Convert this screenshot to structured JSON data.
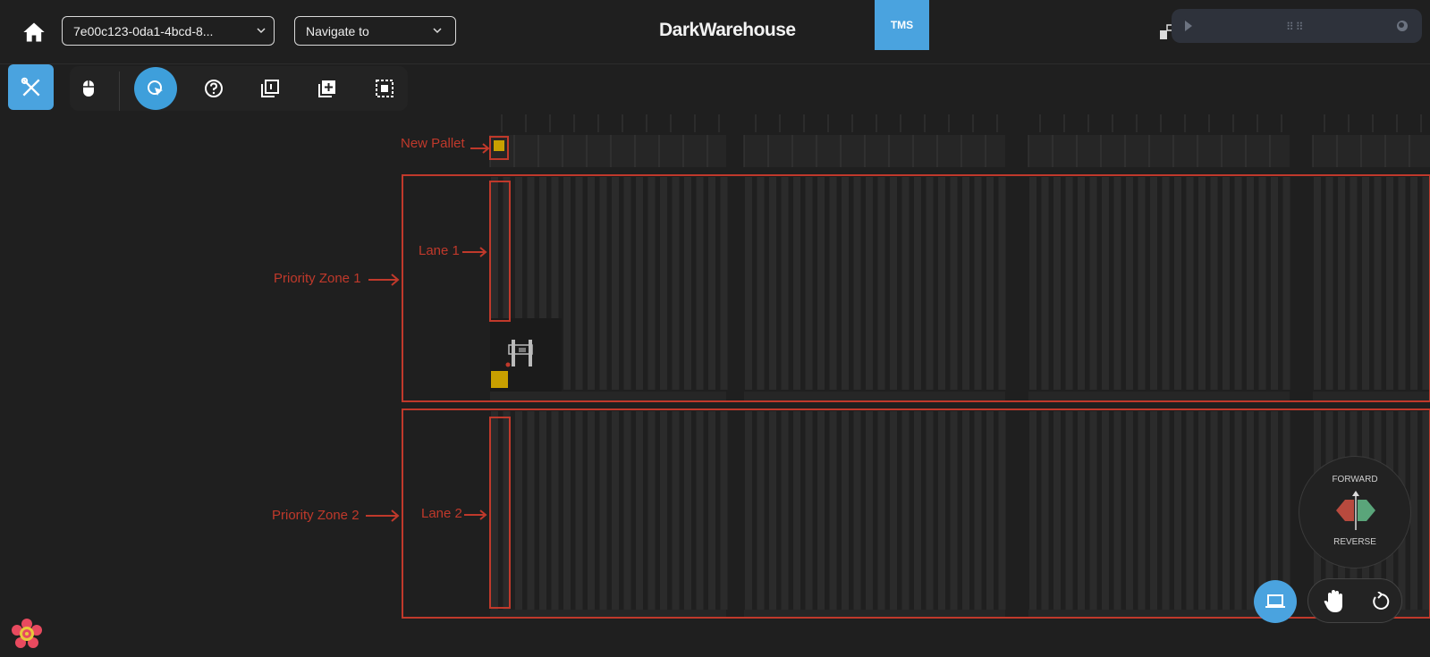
{
  "header": {
    "app_title": "DarkWarehouse",
    "tms_label": "TMS",
    "id_select_value": "7e00c123-0da1-4bcd-8...",
    "navigate_placeholder": "Navigate to"
  },
  "toolbar": {
    "tools": [
      "wrench-icon",
      "mouse-icon",
      "select-cursor-icon",
      "help-icon",
      "layer-1-icon",
      "add-layer-icon",
      "selection-box-icon"
    ],
    "active_tool": "select-cursor-icon"
  },
  "annotations": {
    "new_pallet": "New Pallet",
    "lane1": "Lane 1",
    "lane2": "Lane 2",
    "zone1": "Priority Zone 1",
    "zone2": "Priority Zone 2"
  },
  "joystick": {
    "forward": "FORWARD",
    "reverse": "REVERSE"
  },
  "colors": {
    "accent": "#4aa3df",
    "annotation": "#c0392b",
    "background": "#1f1f1f",
    "lane": "#2a2a2a",
    "pallet": "#c9a000",
    "forward_green": "#5aa57a",
    "reverse_red": "#b84a3e"
  }
}
